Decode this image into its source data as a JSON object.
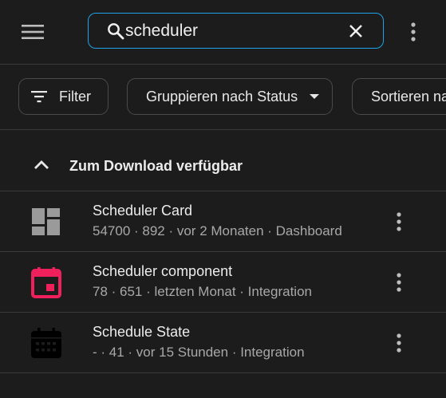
{
  "search": {
    "value": "scheduler"
  },
  "filters": {
    "filter_label": "Filter",
    "group_label": "Gruppieren nach Status",
    "sort_label": "Sortieren nach"
  },
  "group": {
    "title": "Zum Download verfügbar"
  },
  "items": [
    {
      "title": "Scheduler Card",
      "meta": "54700 · 892 · vor 2 Monaten · Dashboard",
      "icon": "dashboard-icon",
      "icon_color": "#9a9a9a"
    },
    {
      "title": "Scheduler component",
      "meta": "78 · 651 · letzten Monat · Integration",
      "icon": "calendar-icon",
      "icon_color": "#f0205c"
    },
    {
      "title": "Schedule State",
      "meta": "- · 41 · vor 15 Stunden · Integration",
      "icon": "calendar-month-icon",
      "icon_color": "#000000"
    }
  ],
  "colors": {
    "accent": "#1ea3e8",
    "background": "#1c1c1c"
  }
}
